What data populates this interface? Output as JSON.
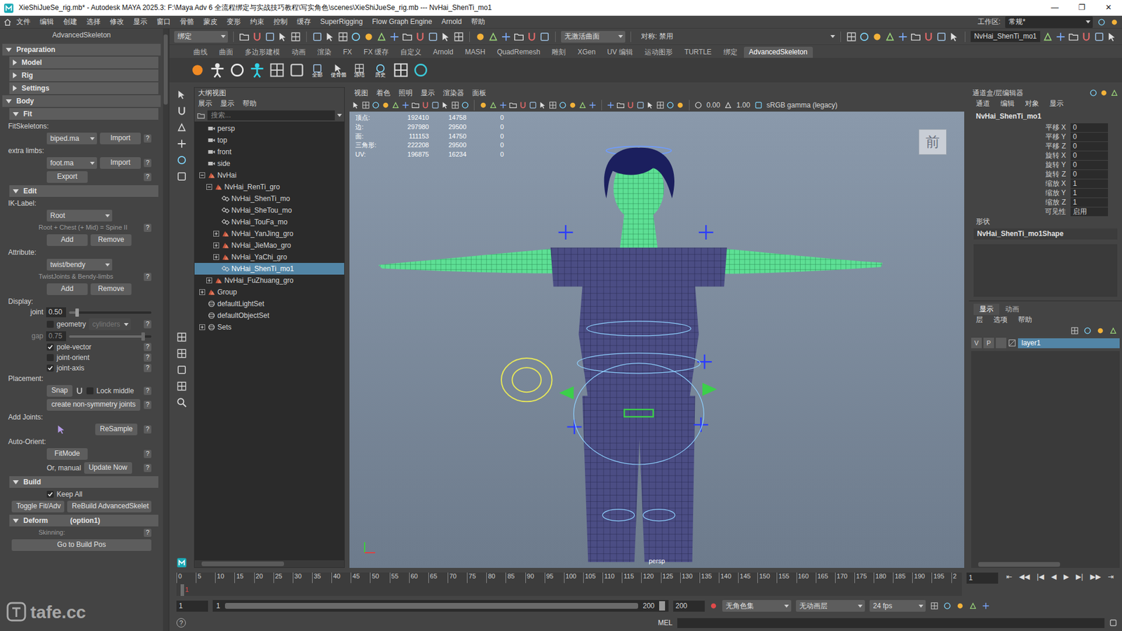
{
  "window": {
    "title": "XieShiJueSe_rig.mb* - Autodesk MAYA 2025.3: F:\\Maya Adv 6 全流程绑定与实战技巧教程\\写实角色\\scenes\\XieShiJueSe_rig.mb  ---  NvHai_ShenTi_mo1",
    "controls": [
      "—",
      "❐",
      "✕"
    ]
  },
  "menu": {
    "items": [
      "文件",
      "编辑",
      "创建",
      "选择",
      "修改",
      "显示",
      "窗口",
      "骨骼",
      "蒙皮",
      "变形",
      "约束",
      "控制",
      "缓存",
      "SuperRigging",
      "Flow Graph Engine",
      "Arnold",
      "帮助"
    ],
    "workspace_label": "工作区:",
    "workspace": "常规*"
  },
  "status_line": {
    "mode": "绑定",
    "live_surface": "无激活曲面",
    "symmetry": "对称: 禁用",
    "object_field": "NvHai_ShenTi_mo1"
  },
  "shelf": {
    "tabs": [
      {
        "label": "曲线",
        "selected": false
      },
      {
        "label": "曲面",
        "selected": false
      },
      {
        "label": "多边形建模",
        "selected": false
      },
      {
        "label": "动画",
        "selected": false
      },
      {
        "label": "渲染",
        "selected": false
      },
      {
        "label": "FX",
        "selected": false
      },
      {
        "label": "FX 缓存",
        "selected": false
      },
      {
        "label": "自定义",
        "selected": false
      },
      {
        "label": "Arnold",
        "selected": false
      },
      {
        "label": "MASH",
        "selected": false
      },
      {
        "label": "QuadRemesh",
        "selected": false
      },
      {
        "label": "雕刻",
        "selected": false
      },
      {
        "label": "XGen",
        "selected": false
      },
      {
        "label": "UV 编辑",
        "selected": false
      },
      {
        "label": "运动图形",
        "selected": false
      },
      {
        "label": "TURTLE",
        "selected": false
      },
      {
        "label": "绑定",
        "selected": false
      },
      {
        "label": "AdvancedSkeleton",
        "selected": true
      }
    ],
    "captions": [
      "全部",
      "使骨骼",
      "冻结",
      "历史"
    ]
  },
  "advanced_skeleton": {
    "title": "AdvancedSkeleton",
    "rows": [
      {
        "kind": "section",
        "label": "Preparation",
        "level": 0,
        "expanded": true
      },
      {
        "kind": "section",
        "label": "Model",
        "level": 1,
        "expanded": false
      },
      {
        "kind": "section",
        "label": "Rig",
        "level": 1,
        "expanded": false
      },
      {
        "kind": "section",
        "label": "Settings",
        "level": 1,
        "expanded": false
      },
      {
        "kind": "section",
        "label": "Body",
        "level": 0,
        "expanded": true
      },
      {
        "kind": "section",
        "label": "Fit",
        "level": 1,
        "expanded": true
      },
      {
        "kind": "label",
        "label": "FitSkeletons:"
      },
      {
        "kind": "combo",
        "value": "biped.ma",
        "button": "Import",
        "help": "?"
      },
      {
        "kind": "label",
        "label": "extra limbs:"
      },
      {
        "kind": "combo",
        "value": "foot.ma",
        "button": "Import",
        "help": "?"
      },
      {
        "kind": "buttons",
        "buttons": [
          "Export"
        ],
        "help": "?"
      },
      {
        "kind": "section",
        "label": "Edit",
        "level": 1,
        "expanded": true
      },
      {
        "kind": "label",
        "label": "IK-Label:"
      },
      {
        "kind": "combo",
        "value": "Root"
      },
      {
        "kind": "note",
        "label": "Root + Chest (+ Mid) = Spine II",
        "help": "?"
      },
      {
        "kind": "buttons",
        "buttons": [
          "Add",
          "Remove"
        ]
      },
      {
        "kind": "label",
        "label": "Attribute:"
      },
      {
        "kind": "combo",
        "value": "twist/bendy"
      },
      {
        "kind": "note",
        "label": "TwistJoints & Bendy-limbs",
        "help": "?"
      },
      {
        "kind": "buttons",
        "buttons": [
          "Add",
          "Remove"
        ]
      },
      {
        "kind": "label",
        "label": "Display:"
      },
      {
        "kind": "slider",
        "label": "joint",
        "value": "0.50",
        "level": 0.1,
        "disabled": false
      },
      {
        "kind": "check",
        "label": "geometry",
        "checked": false,
        "combo": "cylinders",
        "combo_disabled": true,
        "help": "?"
      },
      {
        "kind": "slider",
        "label": "gap",
        "value": "0.75",
        "level": 0.9,
        "disabled": true
      },
      {
        "kind": "check",
        "label": "pole-vector",
        "checked": true,
        "help": "?"
      },
      {
        "kind": "check",
        "label": "joint-orient",
        "checked": false,
        "help": "?"
      },
      {
        "kind": "check",
        "label": "joint-axis",
        "checked": true,
        "help": "?"
      },
      {
        "kind": "label",
        "label": "Placement:"
      },
      {
        "kind": "placement",
        "button": "Snap",
        "label": "Lock middle",
        "checked": false,
        "help": "?"
      },
      {
        "kind": "buttons",
        "buttons": [
          "create non-symmetry joints"
        ],
        "help": "?"
      },
      {
        "kind": "label",
        "label": "Add Joints:"
      },
      {
        "kind": "icon-button",
        "button": "ReSample",
        "help": "?"
      },
      {
        "kind": "label",
        "label": "Auto-Orient:"
      },
      {
        "kind": "buttons",
        "buttons": [
          "FitMode"
        ],
        "help": "?"
      },
      {
        "kind": "label-button",
        "label": "Or, manual",
        "button": "Update Now",
        "help": "?"
      },
      {
        "kind": "section",
        "label": "Build",
        "level": 1,
        "expanded": true
      },
      {
        "kind": "check",
        "label": "Keep All",
        "checked": true
      },
      {
        "kind": "wide-buttons",
        "buttons": [
          "Toggle Fit/Adv",
          "ReBuild AdvancedSkelet"
        ]
      },
      {
        "kind": "section",
        "label": "Deform",
        "suffix": "(option1)",
        "level": 1,
        "expanded": true
      },
      {
        "kind": "note",
        "label": "Skinning:",
        "help": "?"
      },
      {
        "kind": "wide-buttons",
        "buttons": [
          "Go to Build Pos"
        ]
      }
    ]
  },
  "outliner": {
    "title": "大纲视图",
    "menus": [
      "展示",
      "显示",
      "帮助"
    ],
    "search_placeholder": "搜索...",
    "items": [
      {
        "label": "persp",
        "depth": 0,
        "kind": "camera",
        "selected": false
      },
      {
        "label": "top",
        "depth": 0,
        "kind": "camera",
        "selected": false
      },
      {
        "label": "front",
        "depth": 0,
        "kind": "camera",
        "selected": false
      },
      {
        "label": "side",
        "depth": 0,
        "kind": "camera",
        "selected": false
      },
      {
        "label": "NvHai",
        "depth": 0,
        "kind": "group",
        "expanded": true,
        "selected": false
      },
      {
        "label": "NvHai_RenTi_gro",
        "depth": 1,
        "kind": "group",
        "expanded": true,
        "selected": false
      },
      {
        "label": "NvHai_ShenTi_mo",
        "depth": 2,
        "kind": "mesh",
        "selected": false
      },
      {
        "label": "NvHai_SheTou_mo",
        "depth": 2,
        "kind": "mesh",
        "selected": false
      },
      {
        "label": "NvHai_TouFa_mo",
        "depth": 2,
        "kind": "mesh",
        "selected": false
      },
      {
        "label": "NvHai_YanJing_gro",
        "depth": 2,
        "kind": "group",
        "expanded": false,
        "selected": false
      },
      {
        "label": "NvHai_JieMao_gro",
        "depth": 2,
        "kind": "group",
        "expanded": false,
        "selected": false
      },
      {
        "label": "NvHai_YaChi_gro",
        "depth": 2,
        "kind": "group",
        "expanded": false,
        "selected": false
      },
      {
        "label": "NvHai_ShenTi_mo1",
        "depth": 2,
        "kind": "mesh",
        "selected": true
      },
      {
        "label": "NvHai_FuZhuang_gro",
        "depth": 1,
        "kind": "group",
        "expanded": false,
        "selected": false
      },
      {
        "label": "Group",
        "depth": 0,
        "kind": "group",
        "expanded": false,
        "selected": false
      },
      {
        "label": "defaultLightSet",
        "depth": 0,
        "kind": "set",
        "selected": false
      },
      {
        "label": "defaultObjectSet",
        "depth": 0,
        "kind": "set",
        "selected": false
      },
      {
        "label": "Sets",
        "depth": 0,
        "kind": "set",
        "expanded": false,
        "selected": false
      }
    ]
  },
  "viewport": {
    "menus": [
      "视图",
      "着色",
      "照明",
      "显示",
      "渲染器",
      "面板"
    ],
    "exposure": "0.00",
    "gamma": "1.00",
    "color_space": "sRGB gamma (legacy)",
    "hud": [
      {
        "label": "顶点:",
        "values": [
          "192410",
          "14758",
          "0"
        ]
      },
      {
        "label": "边:",
        "values": [
          "297980",
          "29500",
          "0"
        ]
      },
      {
        "label": "面:",
        "values": [
          "111153",
          "14750",
          "0"
        ]
      },
      {
        "label": "三角形:",
        "values": [
          "222208",
          "29500",
          "0"
        ]
      },
      {
        "label": "UV:",
        "values": [
          "196875",
          "16234",
          "0"
        ]
      }
    ],
    "view_cube": "前",
    "camera": "persp"
  },
  "channel_box": {
    "title": "通道盒/层编辑器",
    "menus": [
      "通道",
      "编辑",
      "对象",
      "显示"
    ],
    "object": "NvHai_ShenTi_mo1",
    "attributes": [
      {
        "label": "平移 X",
        "value": "0"
      },
      {
        "label": "平移 Y",
        "value": "0"
      },
      {
        "label": "平移 Z",
        "value": "0"
      },
      {
        "label": "旋转 X",
        "value": "0"
      },
      {
        "label": "旋转 Y",
        "value": "0"
      },
      {
        "label": "旋转 Z",
        "value": "0"
      },
      {
        "label": "缩放 X",
        "value": "1"
      },
      {
        "label": "缩放 Y",
        "value": "1"
      },
      {
        "label": "缩放 Z",
        "value": "1"
      },
      {
        "label": "可见性",
        "value": "启用"
      }
    ],
    "shape_label": "形状",
    "shape": "NvHai_ShenTi_mo1Shape"
  },
  "layer_editor": {
    "tabs": [
      {
        "label": "显示",
        "selected": true
      },
      {
        "label": "动画",
        "selected": false
      }
    ],
    "menus": [
      "层",
      "选项",
      "帮助"
    ],
    "layers": [
      {
        "name": "layer1",
        "visible": "V",
        "playback": "P",
        "selected": true
      }
    ]
  },
  "timeline": {
    "ticks": [
      "0",
      "5",
      "10",
      "15",
      "20",
      "25",
      "30",
      "35",
      "40",
      "45",
      "50",
      "55",
      "60",
      "65",
      "70",
      "75",
      "80",
      "85",
      "90",
      "95",
      "100",
      "105",
      "110",
      "115",
      "120",
      "125",
      "130",
      "135",
      "140",
      "145",
      "150",
      "155",
      "160",
      "165",
      "170",
      "175",
      "180",
      "185",
      "190",
      "195",
      "2"
    ],
    "current_frame": "1",
    "playback": [
      "⇤",
      "◀◀",
      "|◀",
      "◀",
      "▶",
      "▶|",
      "▶▶",
      "⇥"
    ]
  },
  "range": {
    "start": "1",
    "inner_start": "1",
    "inner_end": "200",
    "end": "200",
    "character_set": "无角色集",
    "anim_layer": "无动画层",
    "fps": "24 fps"
  },
  "command_line": {
    "help": "?",
    "language": "MEL"
  },
  "watermark": "tafe.cc"
}
